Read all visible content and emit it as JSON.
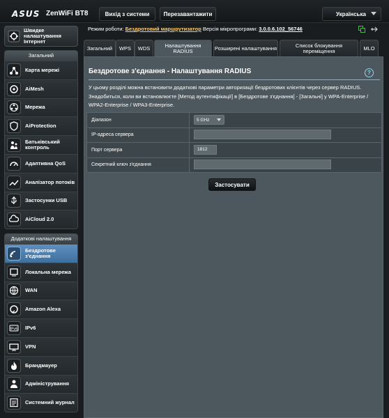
{
  "header": {
    "brand": "ASUS",
    "model": "ZenWiFi BT8",
    "logout_label": "Вихід з системи",
    "reboot_label": "Перезавантажити",
    "language": "Українська"
  },
  "sidebar": {
    "quick_setup": "Швидке налаштування Інтернет",
    "general_title": "Загальний",
    "general_items": [
      {
        "label": "Карта мережі",
        "icon": "network-map-icon"
      },
      {
        "label": "AiMesh",
        "icon": "aimesh-icon"
      },
      {
        "label": "Мережа",
        "icon": "network-icon"
      },
      {
        "label": "AiProtection",
        "icon": "aiprotection-icon"
      },
      {
        "label": "Батьківський контроль",
        "icon": "parental-control-icon"
      },
      {
        "label": "Адаптивна QoS",
        "icon": "qos-icon"
      },
      {
        "label": "Аналізатор потоків",
        "icon": "traffic-analyzer-icon"
      },
      {
        "label": "Застосунки USB",
        "icon": "usb-icon"
      },
      {
        "label": "AiCloud 2.0",
        "icon": "aicloud-icon"
      }
    ],
    "advanced_title": "Додаткові налаштування",
    "advanced_items": [
      {
        "label": "Бездротове з'єднання",
        "icon": "wireless-icon",
        "active": true
      },
      {
        "label": "Локальна мережа",
        "icon": "lan-icon"
      },
      {
        "label": "WAN",
        "icon": "wan-icon"
      },
      {
        "label": "Amazon Alexa",
        "icon": "alexa-icon"
      },
      {
        "label": "IPv6",
        "icon": "ipv6-icon"
      },
      {
        "label": "VPN",
        "icon": "vpn-icon"
      },
      {
        "label": "Брандмауер",
        "icon": "firewall-icon"
      },
      {
        "label": "Адміністрування",
        "icon": "administration-icon"
      },
      {
        "label": "Системний журнал",
        "icon": "system-log-icon"
      }
    ]
  },
  "status": {
    "mode_label": "Режим роботи:",
    "mode_value": "Бездротовий маршрутизатор",
    "fw_label": "Версія мікропрограми:",
    "fw_value": "3.0.0.6.102_56746"
  },
  "tabs": [
    "Загальний",
    "WPS",
    "WDS",
    "Налаштування RADIUS",
    "Розширені налаштування",
    "Список блокування переміщення",
    "MLO"
  ],
  "panel": {
    "title": "Бездротове з'єднання - Налаштування RADIUS",
    "description": "У цьому розділі можна встановити додаткові параметри авторизації бездротових клієнтів через сервер RADIUS. Знадобиться, коли ви встановлюєте [Метод аутентифікації] в [Бездротове з'єднання] - [Загальні] у WPA-Enterprise / WPA2-Enterprise / WPA3-Enterprise.",
    "fields": {
      "band_label": "Діапазон",
      "band_value": "5 GHz",
      "ip_label": "IP-адреса сервера",
      "ip_value": "",
      "port_label": "Порт сервера",
      "port_value": "1812",
      "secret_label": "Секретний ключ з'єднання",
      "secret_value": ""
    },
    "apply_label": "Застосувати"
  }
}
